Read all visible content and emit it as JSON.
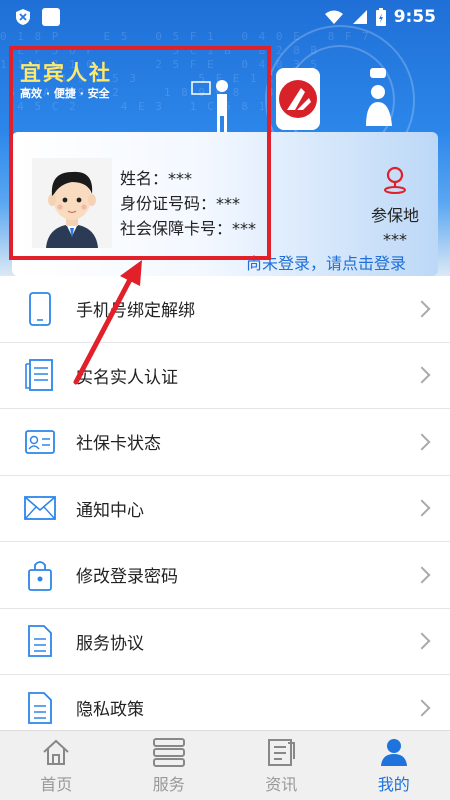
{
  "status_bar": {
    "time": "9:55"
  },
  "brand": {
    "title": "宜宾人社",
    "slogan": "高效 · 便捷 · 安全"
  },
  "card": {
    "name_line": "姓名：***",
    "id_line": "身份证号码：***",
    "ssc_line": "社会保障卡号：***",
    "location_label": "参保地",
    "location_value": "***",
    "login_prompt": "尚未登录，请点击登录"
  },
  "menu": [
    {
      "label": "手机号绑定解绑",
      "icon": "phone-icon"
    },
    {
      "label": "实名实人认证",
      "icon": "document-icon"
    },
    {
      "label": "社保卡状态",
      "icon": "id-card-icon"
    },
    {
      "label": "通知中心",
      "icon": "mail-icon"
    },
    {
      "label": "修改登录密码",
      "icon": "lock-bag-icon"
    },
    {
      "label": "服务协议",
      "icon": "file-icon"
    },
    {
      "label": "隐私政策",
      "icon": "file-icon"
    }
  ],
  "tabs": [
    {
      "label": "首页",
      "icon": "home-icon"
    },
    {
      "label": "服务",
      "icon": "service-icon"
    },
    {
      "label": "资讯",
      "icon": "news-icon"
    },
    {
      "label": "我的",
      "icon": "user-icon",
      "active": true
    }
  ],
  "colors": {
    "accent": "#1e73dc",
    "annotation": "#e2202a",
    "brand_yellow": "#ffe96b"
  }
}
